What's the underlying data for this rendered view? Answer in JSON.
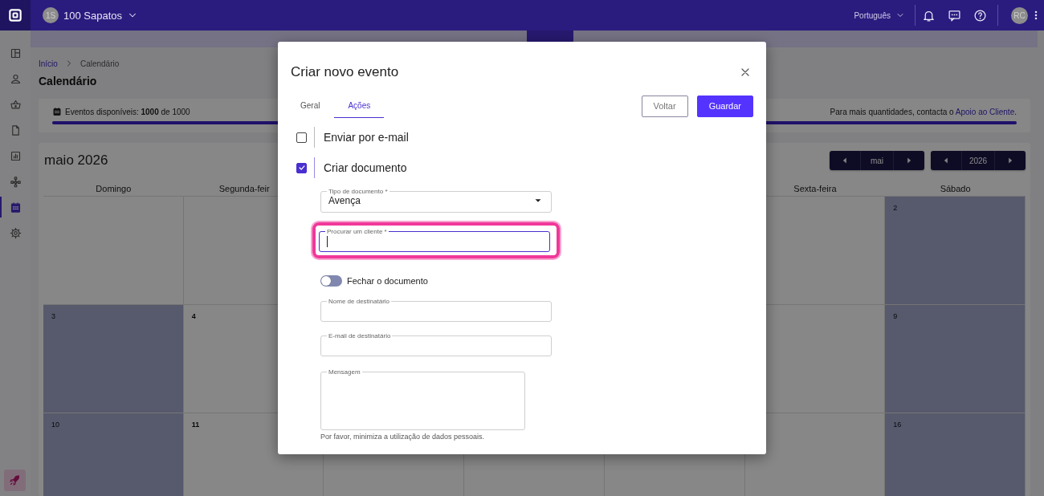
{
  "top_bar": {
    "company_initials": "1S",
    "company_name": "100 Sapatos",
    "language": "Português",
    "user_initials": "RC"
  },
  "sidebar": {
    "items": [
      {
        "kind": "dashboard",
        "selected": false
      },
      {
        "kind": "person",
        "selected": false
      },
      {
        "kind": "basket",
        "selected": false
      },
      {
        "kind": "document",
        "selected": false
      },
      {
        "kind": "chart",
        "selected": false
      },
      {
        "kind": "network",
        "selected": false
      },
      {
        "kind": "calendar",
        "selected": true
      },
      {
        "kind": "gear",
        "selected": false
      }
    ]
  },
  "breadcrumb": [
    {
      "label": "Início",
      "link": true
    },
    {
      "label": "Calendário",
      "link": false
    }
  ],
  "page_title": "Calendário",
  "usage": {
    "text": "Eventos disponíveis: **1000** de 1000",
    "level": 1,
    "note": "Para mais quantidades, contacta o",
    "link": "Apoio ao Cliente",
    "note_end": "."
  },
  "calendar": {
    "title": "maio 2026",
    "month": "mai",
    "year": "2026",
    "weekdays": [
      {
        "label": "Domingo"
      },
      {
        "label": "Segunda-feir"
      },
      {
        "label": "Sexta-feira"
      },
      {
        "label": "Sábado"
      }
    ],
    "weeks": [
      [
        {
          "weekend": false
        },
        {
          "weekend": false
        },
        {
          "weekend": false
        },
        {
          "weekend": true,
          "day": "2"
        }
      ],
      [
        {
          "weekend": true,
          "day": "3"
        },
        {
          "weekend": false,
          "day": "4"
        },
        {
          "weekend": false
        },
        {
          "weekend": true,
          "day": "9"
        }
      ],
      [
        {
          "weekend": true,
          "day": "10"
        },
        {
          "weekend": false,
          "day": "11"
        },
        {
          "weekend": false
        },
        {
          "weekend": true,
          "day": "16"
        }
      ]
    ]
  },
  "modal": {
    "title": "Criar novo evento",
    "tabs": [
      {
        "label": "Geral",
        "selected": false
      },
      {
        "label": "Ações",
        "selected": true
      }
    ],
    "buttons": [
      {
        "label": "Voltar",
        "kind": "outline"
      },
      {
        "label": "Guardar",
        "kind": "primary"
      }
    ],
    "actions": [
      {
        "label": "Enviar por e-mail",
        "checked": false
      },
      {
        "label": "Criar documento",
        "checked": true
      }
    ],
    "fields": [
      {
        "kind": "select",
        "label": "Tipo de documento *",
        "value": "Avença"
      },
      {
        "kind": "text",
        "label": "Procurar um cliente *",
        "focused": true
      },
      {
        "kind": "toggle",
        "label": "Fechar o documento",
        "on": false
      },
      {
        "kind": "text",
        "label": "Nome de destinatário",
        "focused": false
      },
      {
        "kind": "text",
        "label": "E-mail de destinatário",
        "focused": false
      },
      {
        "kind": "textarea",
        "label": "Mensagem",
        "hint": "Por favor, minimiza a utilização de dados pessoais."
      }
    ]
  }
}
